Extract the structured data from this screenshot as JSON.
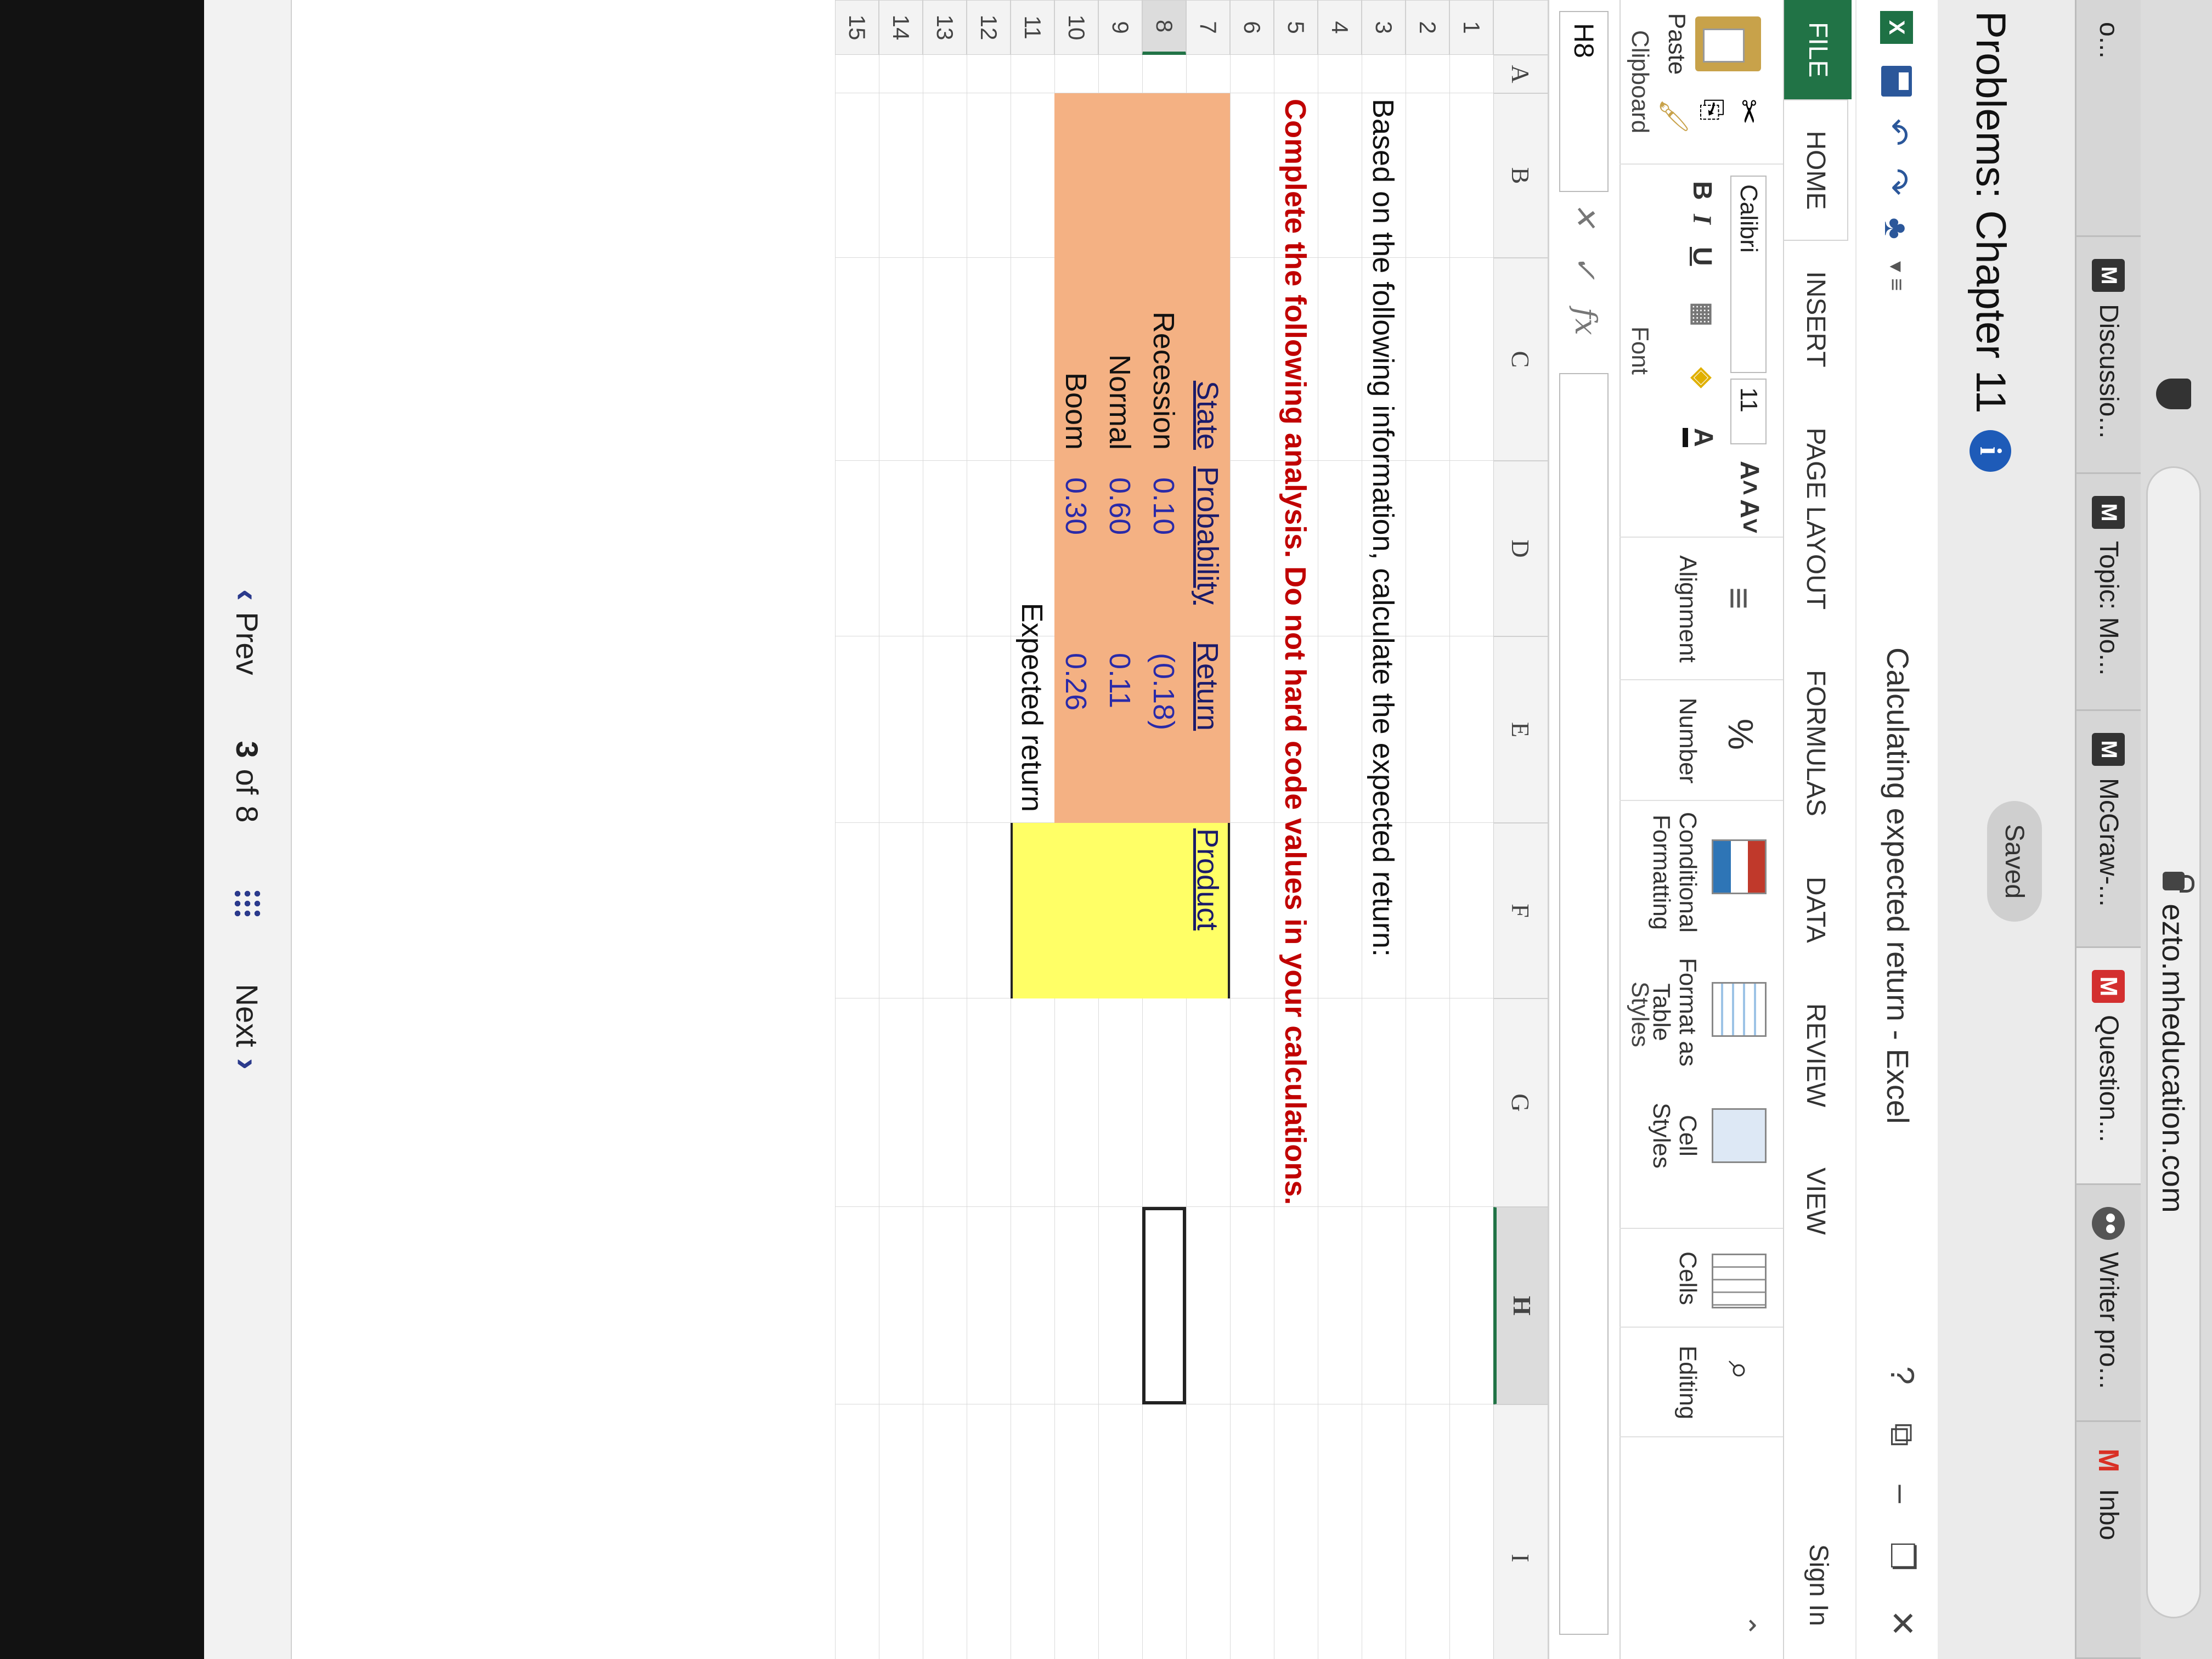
{
  "browser": {
    "url": "ezto.mheducation.com",
    "tabs": [
      {
        "label": "o...",
        "icon": "none"
      },
      {
        "label": "Discussio...",
        "icon": "mh-logo"
      },
      {
        "label": "Topic: Mo...",
        "icon": "mh-logo"
      },
      {
        "label": "McGraw-...",
        "icon": "mh-logo"
      },
      {
        "label": "Question...",
        "icon": "m-logo"
      },
      {
        "label": "Writer pro...",
        "icon": "owl-logo"
      },
      {
        "label": "Inbo",
        "icon": "gmail-logo"
      }
    ]
  },
  "page": {
    "title": "Problems: Chapter 11",
    "saved_label": "Saved"
  },
  "excel": {
    "window_title": "Calculating expected return - Excel",
    "help": "?",
    "sign_in": "Sign In",
    "ribbon_tabs": [
      "FILE",
      "HOME",
      "INSERT",
      "PAGE LAYOUT",
      "FORMULAS",
      "DATA",
      "REVIEW",
      "VIEW"
    ],
    "ribbon": {
      "paste": "Paste",
      "clipboard": "Clipboard",
      "font_name": "Calibri",
      "font_size": "11",
      "bold": "B",
      "italic": "I",
      "underline": "U",
      "grow": "A˄",
      "shrink": "A˅",
      "font_color": "A",
      "font_group": "Font",
      "alignment": "Alignment",
      "number": "Number",
      "percent": "%",
      "conditional": "Conditional Formatting",
      "format_table": "Format as Table",
      "cell_styles": "Cell Styles",
      "styles_group": "Styles",
      "cells": "Cells",
      "editing": "Editing"
    },
    "name_box": "H8",
    "fx": "fx",
    "columns": [
      "A",
      "B",
      "C",
      "D",
      "E",
      "F",
      "G",
      "H",
      "I"
    ],
    "rows": [
      "1",
      "2",
      "3",
      "4",
      "5",
      "6",
      "7",
      "8",
      "9",
      "10",
      "11",
      "12",
      "13",
      "14",
      "15"
    ],
    "selected_cell": "H8",
    "content": {
      "instruction": "Based on the following information, calculate the expected return:",
      "warning": "Complete the following analysis. Do not hard code values in your calculations.",
      "headers": {
        "state": "State",
        "probability": "Probability",
        "return": "Return",
        "product": "Product"
      },
      "table": [
        {
          "state": "Recession",
          "probability": "0.10",
          "return": "(0.18)"
        },
        {
          "state": "Normal",
          "probability": "0.60",
          "return": "0.11"
        },
        {
          "state": "Boom",
          "probability": "0.30",
          "return": "0.26"
        }
      ],
      "expected_return_label": "Expected return"
    },
    "colors": {
      "table_fill": "#f4b183",
      "input_fill": "#ffff66",
      "warning": "#c00000",
      "excel_green": "#217346"
    }
  },
  "nav": {
    "prev": "Prev",
    "page_current": "3",
    "page_of": "of",
    "page_total": "8",
    "next": "Next"
  }
}
